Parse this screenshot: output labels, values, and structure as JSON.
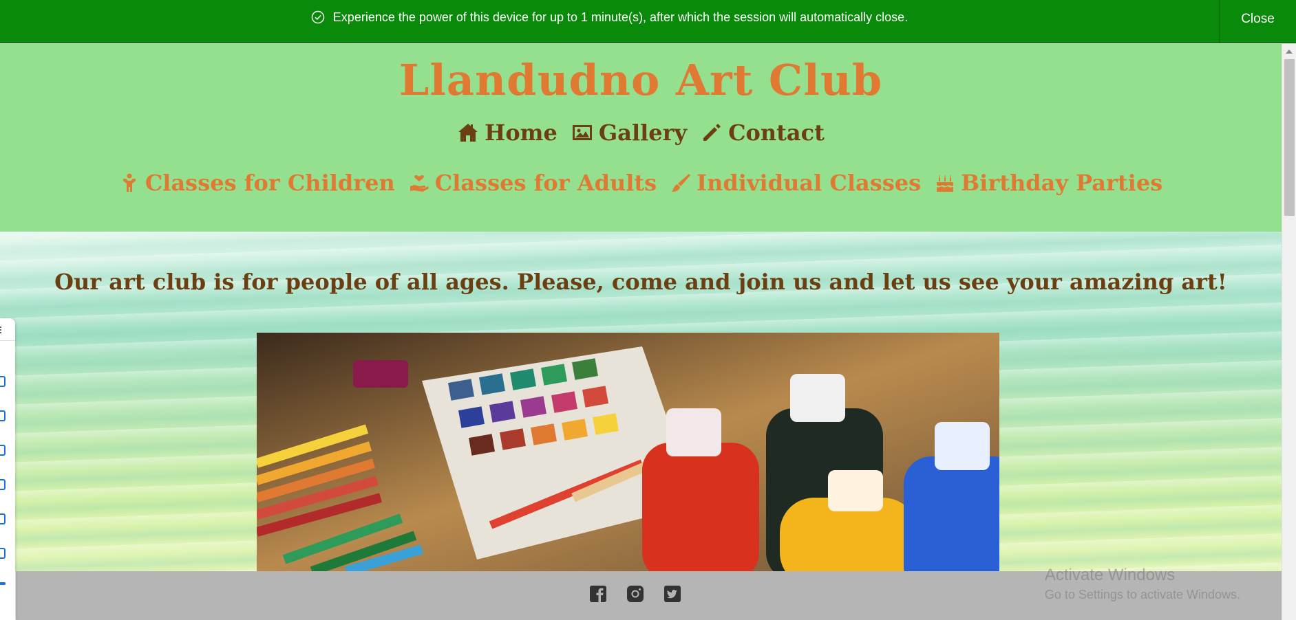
{
  "banner": {
    "message": "Experience the power of this device for up to 1 minute(s), after which the session will automatically close.",
    "close_label": "Close",
    "icon": "check-circle-icon",
    "color": "#0a8a0a"
  },
  "header": {
    "title": "Llandudno Art Club",
    "title_color": "#e07a33",
    "background": "#95e08e",
    "nav_primary": [
      {
        "label": "Home",
        "icon": "home-icon"
      },
      {
        "label": "Gallery",
        "icon": "image-icon"
      },
      {
        "label": "Contact",
        "icon": "pencil-icon"
      }
    ],
    "nav_secondary": [
      {
        "label": "Classes for Children",
        "icon": "child-icon"
      },
      {
        "label": "Classes for Adults",
        "icon": "hand-holding-heart-icon"
      },
      {
        "label": "Individual Classes",
        "icon": "paint-brush-icon"
      },
      {
        "label": "Birthday Parties",
        "icon": "birthday-cake-icon"
      }
    ]
  },
  "main": {
    "tagline": "Our art club is for people of all ages. Please, come and join us and let us see your amazing art!",
    "hero_image": "art-supplies-photo"
  },
  "footer": {
    "social": [
      {
        "name": "facebook-icon"
      },
      {
        "name": "instagram-icon"
      },
      {
        "name": "twitter-icon"
      }
    ],
    "watermark_line1": "Activate Windows",
    "watermark_line2": "Go to Settings to activate Windows."
  }
}
